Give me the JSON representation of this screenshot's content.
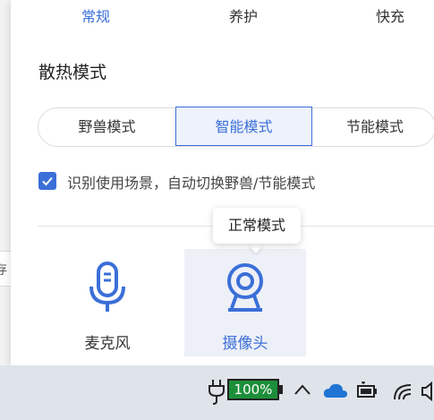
{
  "tabs": [
    {
      "label": "常规",
      "active": true
    },
    {
      "label": "养护",
      "active": false
    },
    {
      "label": "快充",
      "active": false
    }
  ],
  "cooling": {
    "title": "散热模式",
    "modes": [
      {
        "label": "野兽模式",
        "selected": false
      },
      {
        "label": "智能模式",
        "selected": true
      },
      {
        "label": "节能模式",
        "selected": false
      }
    ],
    "auto_switch": {
      "checked": true,
      "label": "识别使用场景，自动切换野兽/节能模式"
    }
  },
  "tooltip": {
    "text": "正常模式"
  },
  "devices": [
    {
      "label": "麦克风",
      "icon": "microphone-icon",
      "selected": false
    },
    {
      "label": "摄像头",
      "icon": "camera-icon",
      "selected": true
    }
  ],
  "background_window": {
    "fragment": "存"
  },
  "taskbar": {
    "battery_percent": "100%",
    "icons": [
      "plug-icon",
      "battery-icon",
      "chevron-up-icon",
      "onedrive-cloud-icon",
      "battery-status-icon",
      "wifi-icon",
      "speaker-icon"
    ]
  },
  "colors": {
    "accent": "#3b6fd8",
    "selected_bg": "#eef2fd",
    "battery_green": "#1d8f3a"
  }
}
